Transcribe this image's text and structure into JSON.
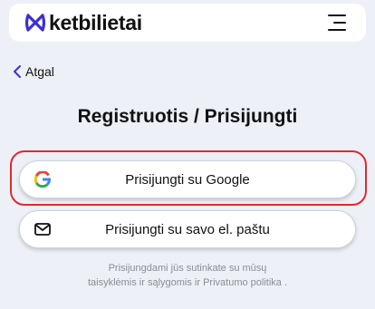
{
  "header": {
    "brand": "ketbilietai"
  },
  "nav": {
    "back_label": "Atgal"
  },
  "main": {
    "title": "Registruotis / Prisijungti",
    "google_button": "Prisijungti su Google",
    "email_button": "Prisijungti su savo el. paštu"
  },
  "terms": {
    "line1": "Prisijungdami jūs sutinkate su mūsų",
    "line2": "taisyklėmis ir sąlygomis ir Privatumo politika ."
  },
  "colors": {
    "background": "#eef0f7",
    "brand_accent": "#3b2fd6",
    "highlight": "#e3282e",
    "muted_text": "#8a8d96"
  },
  "icons": {
    "logo": "ketbilietai-logo-icon",
    "menu": "hamburger-menu-icon",
    "back": "chevron-left-icon",
    "google": "google-g-icon",
    "email": "envelope-icon"
  }
}
